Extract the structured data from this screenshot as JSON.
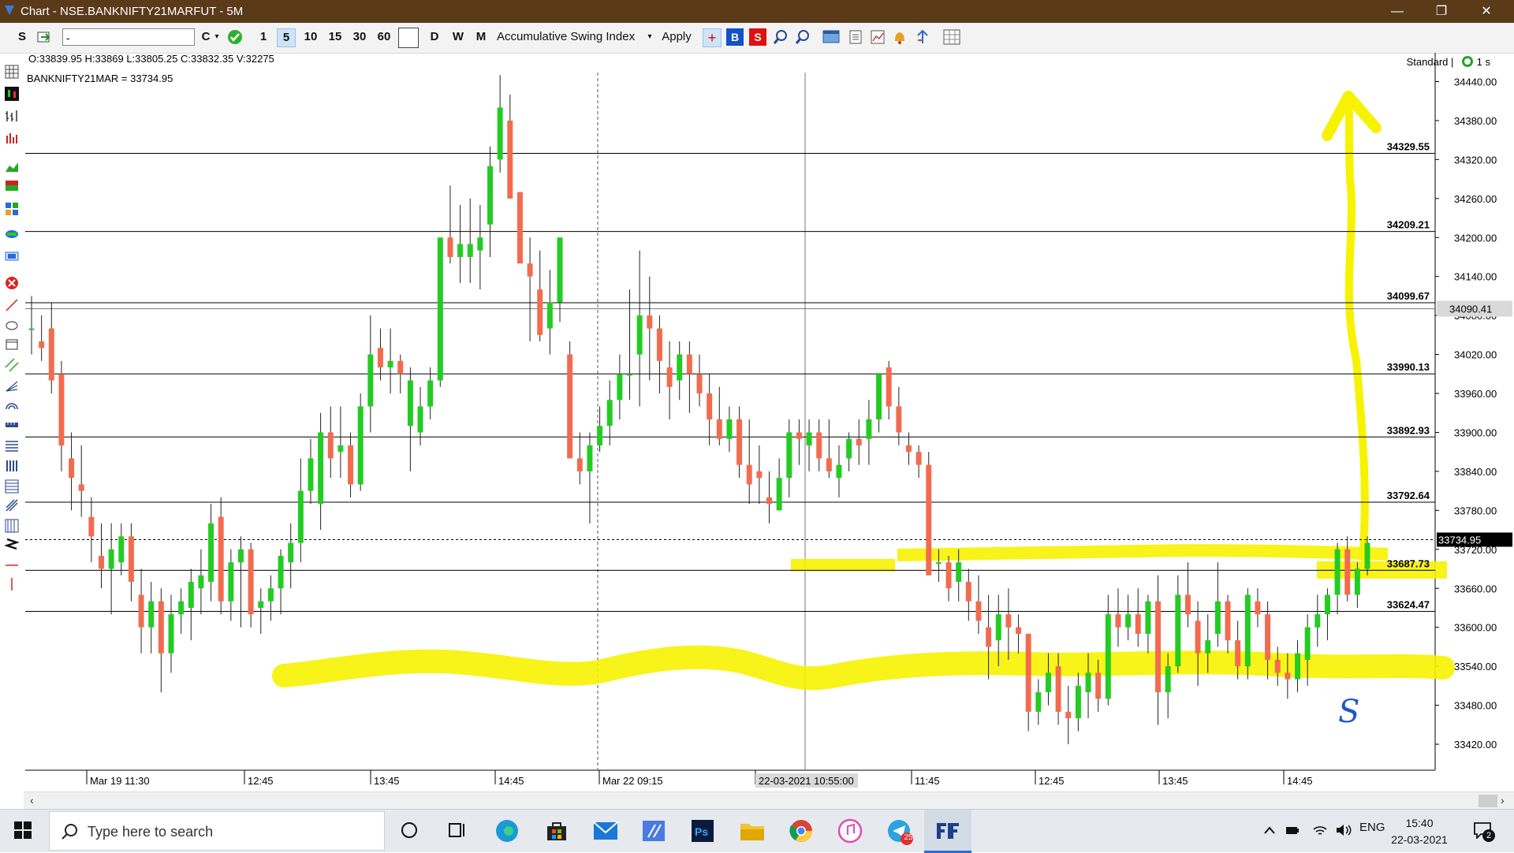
{
  "window": {
    "title": "Chart - NSE.BANKNIFTY21MARFUT - 5M",
    "controls": [
      "—",
      "❐",
      "✕"
    ]
  },
  "toolbar": {
    "s_label": "S",
    "symbol_value": "-",
    "c_label": "C",
    "intervals": [
      "1",
      "5",
      "10",
      "15",
      "30",
      "60"
    ],
    "selected_interval": "5",
    "periods": [
      "D",
      "W",
      "M"
    ],
    "indicator": "Accumulative Swing Index",
    "apply_label": "Apply",
    "b_label": "B",
    "s_red_label": "S"
  },
  "info": {
    "ohlcv": "O:33839.95   H:33869   L:33805.25   C:33832.35   V:32275",
    "last": "BANKNIFTY21MAR = 33734.95",
    "mode": "Standard |",
    "refresh": "1 s"
  },
  "chart_data": {
    "type": "candlestick",
    "symbol": "BANKNIFTY21MAR",
    "interval": "5M",
    "ylim": [
      33380,
      34460
    ],
    "y_ticks": [
      33420,
      33480,
      33540,
      33600,
      33660,
      33720,
      33780,
      33840,
      33900,
      33960,
      34020,
      34080,
      34140,
      34200,
      34260,
      34320,
      34380,
      34440
    ],
    "y_tick_labels": [
      "33420.00",
      "33480.00",
      "33540.00",
      "33600.00",
      "33660.00",
      "33720.00",
      "33780.00",
      "33840.00",
      "33900.00",
      "33960.00",
      "34020.00",
      "34080.00",
      "34140.00",
      "34200.00",
      "34260.00",
      "34320.00",
      "34380.00",
      "34440.00"
    ],
    "x_labels": [
      "Mar 19 11:30",
      "12:45",
      "13:45",
      "14:45",
      "Mar 22 09:15",
      "22-03-2021 10:55:00",
      "11:45",
      "12:45",
      "13:45",
      "14:45"
    ],
    "levels": [
      {
        "value": 34329.55,
        "label": "34329.55"
      },
      {
        "value": 34209.21,
        "label": "34209.21"
      },
      {
        "value": 34099.67,
        "label": "34099.67"
      },
      {
        "value": 33990.13,
        "label": "33990.13"
      },
      {
        "value": 33892.93,
        "label": "33892.93"
      },
      {
        "value": 33792.64,
        "label": "33792.64"
      },
      {
        "value": 33687.73,
        "label": "33687.73"
      },
      {
        "value": 33624.47,
        "label": "33624.47"
      }
    ],
    "crosshair_price": {
      "value": 34090.41,
      "label": "34090.41"
    },
    "last_price": {
      "value": 33734.95,
      "label": "33734.95"
    },
    "grid": false,
    "candles": [
      [
        34060,
        34110,
        34020,
        34060
      ],
      [
        34040,
        34080,
        34010,
        34030
      ],
      [
        34060,
        34100,
        33960,
        33980
      ],
      [
        33990,
        34010,
        33840,
        33880
      ],
      [
        33860,
        33900,
        33780,
        33830
      ],
      [
        33820,
        33880,
        33770,
        33810
      ],
      [
        33770,
        33800,
        33700,
        33740
      ],
      [
        33710,
        33760,
        33660,
        33690
      ],
      [
        33690,
        33760,
        33620,
        33720
      ],
      [
        33700,
        33760,
        33680,
        33740
      ],
      [
        33740,
        33760,
        33640,
        33670
      ],
      [
        33650,
        33690,
        33560,
        33600
      ],
      [
        33600,
        33670,
        33560,
        33640
      ],
      [
        33640,
        33660,
        33500,
        33560
      ],
      [
        33560,
        33650,
        33530,
        33620
      ],
      [
        33620,
        33660,
        33590,
        33640
      ],
      [
        33630,
        33690,
        33580,
        33670
      ],
      [
        33660,
        33720,
        33620,
        33680
      ],
      [
        33670,
        33790,
        33640,
        33760
      ],
      [
        33770,
        33800,
        33620,
        33640
      ],
      [
        33640,
        33720,
        33610,
        33700
      ],
      [
        33700,
        33740,
        33600,
        33720
      ],
      [
        33720,
        33730,
        33600,
        33620
      ],
      [
        33630,
        33660,
        33590,
        33640
      ],
      [
        33640,
        33680,
        33610,
        33660
      ],
      [
        33660,
        33720,
        33620,
        33710
      ],
      [
        33700,
        33760,
        33660,
        33730
      ],
      [
        33730,
        33860,
        33700,
        33810
      ],
      [
        33810,
        33890,
        33790,
        33860
      ],
      [
        33790,
        33930,
        33750,
        33900
      ],
      [
        33900,
        33940,
        33830,
        33860
      ],
      [
        33870,
        33940,
        33830,
        33880
      ],
      [
        33880,
        33900,
        33800,
        33820
      ],
      [
        33820,
        33960,
        33810,
        33940
      ],
      [
        33940,
        34080,
        33900,
        34020
      ],
      [
        34030,
        34060,
        33980,
        34000
      ],
      [
        34000,
        34060,
        33960,
        34010
      ],
      [
        34010,
        34020,
        33960,
        33990
      ],
      [
        33910,
        34000,
        33840,
        33980
      ],
      [
        33900,
        33970,
        33880,
        33940
      ],
      [
        33940,
        34000,
        33920,
        33980
      ],
      [
        33980,
        34200,
        33970,
        34200
      ],
      [
        34200,
        34280,
        34160,
        34170
      ],
      [
        34170,
        34250,
        34130,
        34190
      ],
      [
        34170,
        34260,
        34130,
        34190
      ],
      [
        34180,
        34250,
        34120,
        34200
      ],
      [
        34220,
        34340,
        34170,
        34310
      ],
      [
        34320,
        34450,
        34300,
        34400
      ],
      [
        34380,
        34420,
        34260,
        34260
      ],
      [
        34270,
        34260,
        34180,
        34160
      ],
      [
        34160,
        34200,
        34040,
        34140
      ],
      [
        34120,
        34180,
        34040,
        34050
      ],
      [
        34060,
        34150,
        34020,
        34100
      ],
      [
        34100,
        34200,
        34070,
        34200
      ],
      [
        34020,
        34040,
        33870,
        33860
      ],
      [
        33860,
        33900,
        33820,
        33840
      ],
      [
        33840,
        33900,
        33760,
        33880
      ],
      [
        33880,
        33940,
        33870,
        33910
      ],
      [
        33910,
        33980,
        33880,
        33950
      ],
      [
        33950,
        34020,
        33920,
        33990
      ],
      [
        33990,
        34120,
        33950,
        33990
      ],
      [
        34020,
        34180,
        33940,
        34080
      ],
      [
        34080,
        34140,
        33980,
        34060
      ],
      [
        34060,
        34080,
        33960,
        34010
      ],
      [
        34000,
        34040,
        33920,
        33970
      ],
      [
        33980,
        34040,
        33950,
        34020
      ],
      [
        34020,
        34040,
        33930,
        33990
      ],
      [
        33990,
        34020,
        33940,
        33960
      ],
      [
        33960,
        33990,
        33880,
        33920
      ],
      [
        33920,
        33970,
        33880,
        33890
      ],
      [
        33890,
        33940,
        33870,
        33920
      ],
      [
        33920,
        33940,
        33830,
        33850
      ],
      [
        33850,
        33920,
        33790,
        33820
      ],
      [
        33840,
        33880,
        33790,
        33830
      ],
      [
        33800,
        33840,
        33760,
        33790
      ],
      [
        33780,
        33860,
        33780,
        33830
      ],
      [
        33830,
        33920,
        33800,
        33900
      ],
      [
        33900,
        33920,
        33850,
        33890
      ],
      [
        33880,
        33920,
        33840,
        33900
      ],
      [
        33900,
        33920,
        33840,
        33860
      ],
      [
        33860,
        33920,
        33830,
        33840
      ],
      [
        33830,
        33880,
        33800,
        33850
      ],
      [
        33860,
        33900,
        33840,
        33890
      ],
      [
        33890,
        33920,
        33850,
        33880
      ],
      [
        33890,
        33950,
        33850,
        33920
      ],
      [
        33920,
        33990,
        33900,
        33990
      ],
      [
        34000,
        34010,
        33920,
        33940
      ],
      [
        33940,
        33970,
        33880,
        33900
      ],
      [
        33880,
        33900,
        33850,
        33870
      ],
      [
        33870,
        33880,
        33830,
        33850
      ],
      [
        33850,
        33870,
        33690,
        33680
      ],
      [
        33700,
        33720,
        33670,
        33700
      ],
      [
        33700,
        33710,
        33640,
        33660
      ],
      [
        33670,
        33720,
        33640,
        33700
      ],
      [
        33670,
        33690,
        33610,
        33640
      ],
      [
        33640,
        33680,
        33590,
        33610
      ],
      [
        33600,
        33650,
        33520,
        33570
      ],
      [
        33580,
        33650,
        33540,
        33620
      ],
      [
        33620,
        33660,
        33550,
        33600
      ],
      [
        33600,
        33620,
        33560,
        33590
      ],
      [
        33590,
        33590,
        33440,
        33470
      ],
      [
        33470,
        33520,
        33450,
        33500
      ],
      [
        33500,
        33560,
        33480,
        33530
      ],
      [
        33540,
        33560,
        33450,
        33470
      ],
      [
        33470,
        33510,
        33420,
        33460
      ],
      [
        33460,
        33530,
        33440,
        33510
      ],
      [
        33500,
        33560,
        33460,
        33530
      ],
      [
        33530,
        33550,
        33470,
        33490
      ],
      [
        33490,
        33650,
        33480,
        33620
      ],
      [
        33620,
        33660,
        33570,
        33600
      ],
      [
        33600,
        33650,
        33580,
        33620
      ],
      [
        33620,
        33660,
        33570,
        33590
      ],
      [
        33590,
        33650,
        33560,
        33640
      ],
      [
        33640,
        33680,
        33450,
        33500
      ],
      [
        33500,
        33560,
        33460,
        33540
      ],
      [
        33540,
        33680,
        33530,
        33650
      ],
      [
        33650,
        33700,
        33600,
        33620
      ],
      [
        33610,
        33640,
        33510,
        33560
      ],
      [
        33560,
        33620,
        33530,
        33580
      ],
      [
        33590,
        33700,
        33570,
        33640
      ],
      [
        33640,
        33650,
        33560,
        33580
      ],
      [
        33580,
        33610,
        33520,
        33540
      ],
      [
        33540,
        33660,
        33520,
        33650
      ],
      [
        33640,
        33660,
        33600,
        33620
      ],
      [
        33620,
        33640,
        33520,
        33550
      ],
      [
        33550,
        33570,
        33510,
        33530
      ],
      [
        33530,
        33560,
        33490,
        33520
      ],
      [
        33520,
        33580,
        33500,
        33560
      ],
      [
        33550,
        33620,
        33510,
        33600
      ],
      [
        33600,
        33650,
        33570,
        33620
      ],
      [
        33620,
        33660,
        33580,
        33650
      ],
      [
        33650,
        33730,
        33620,
        33720
      ],
      [
        33720,
        33740,
        33640,
        33650
      ],
      [
        33650,
        33700,
        33630,
        33690
      ],
      [
        33690,
        33740,
        33680,
        33730
      ]
    ]
  },
  "annotations": {
    "handwritten_mark": "S"
  },
  "taskbar": {
    "search_placeholder": "Type here to search",
    "lang": "ENG",
    "time": "15:40",
    "date": "22-03-2021",
    "notif_count": "2",
    "telegram_badge": "25",
    "apps": [
      "task-view",
      "edge",
      "store",
      "mail",
      "app-a",
      "photoshop",
      "explorer",
      "chrome",
      "itunes",
      "telegram",
      "trading-app"
    ]
  },
  "colors": {
    "up": "#22cc22",
    "down": "#f26b4f",
    "highlight": "#f7f200",
    "titlebar": "#5b3a1a"
  }
}
